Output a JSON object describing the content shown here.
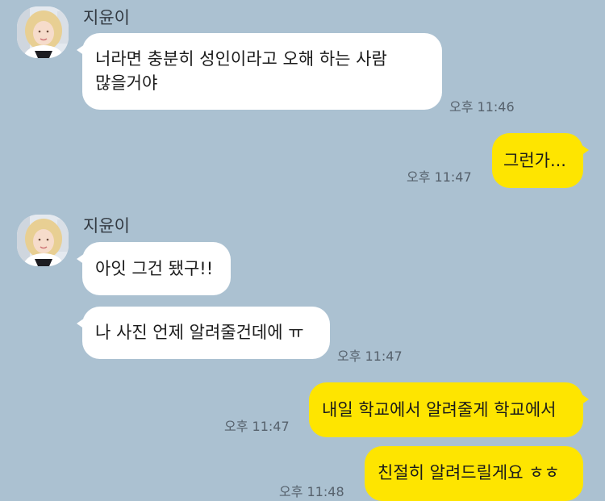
{
  "chat": {
    "messages": [
      {
        "sender": "지윤이",
        "text": [
          "너라면 충분히 성인이라고 오해 하는 사람",
          "많을거야"
        ],
        "time": "오후 11:46"
      },
      {
        "text": "그런가...",
        "time": "오후 11:47"
      },
      {
        "sender": "지윤이",
        "text": "아잇 그건 됐구!!"
      },
      {
        "text": "나 사진 언제 알려줄건데에 ㅠ",
        "time": "오후 11:47"
      },
      {
        "text": "내일 학교에서 알려줄게 학교에서",
        "time": "오후 11:47"
      },
      {
        "text": "친절히 알려드릴게요 ㅎㅎ",
        "time": "오후 11:48"
      }
    ]
  },
  "colors": {
    "background": "#abc1d1",
    "incoming_bubble": "#ffffff",
    "outgoing_bubble": "#fee500",
    "timestamp": "#56616c"
  },
  "icons": {
    "avatar": "profile-photo-icon"
  }
}
